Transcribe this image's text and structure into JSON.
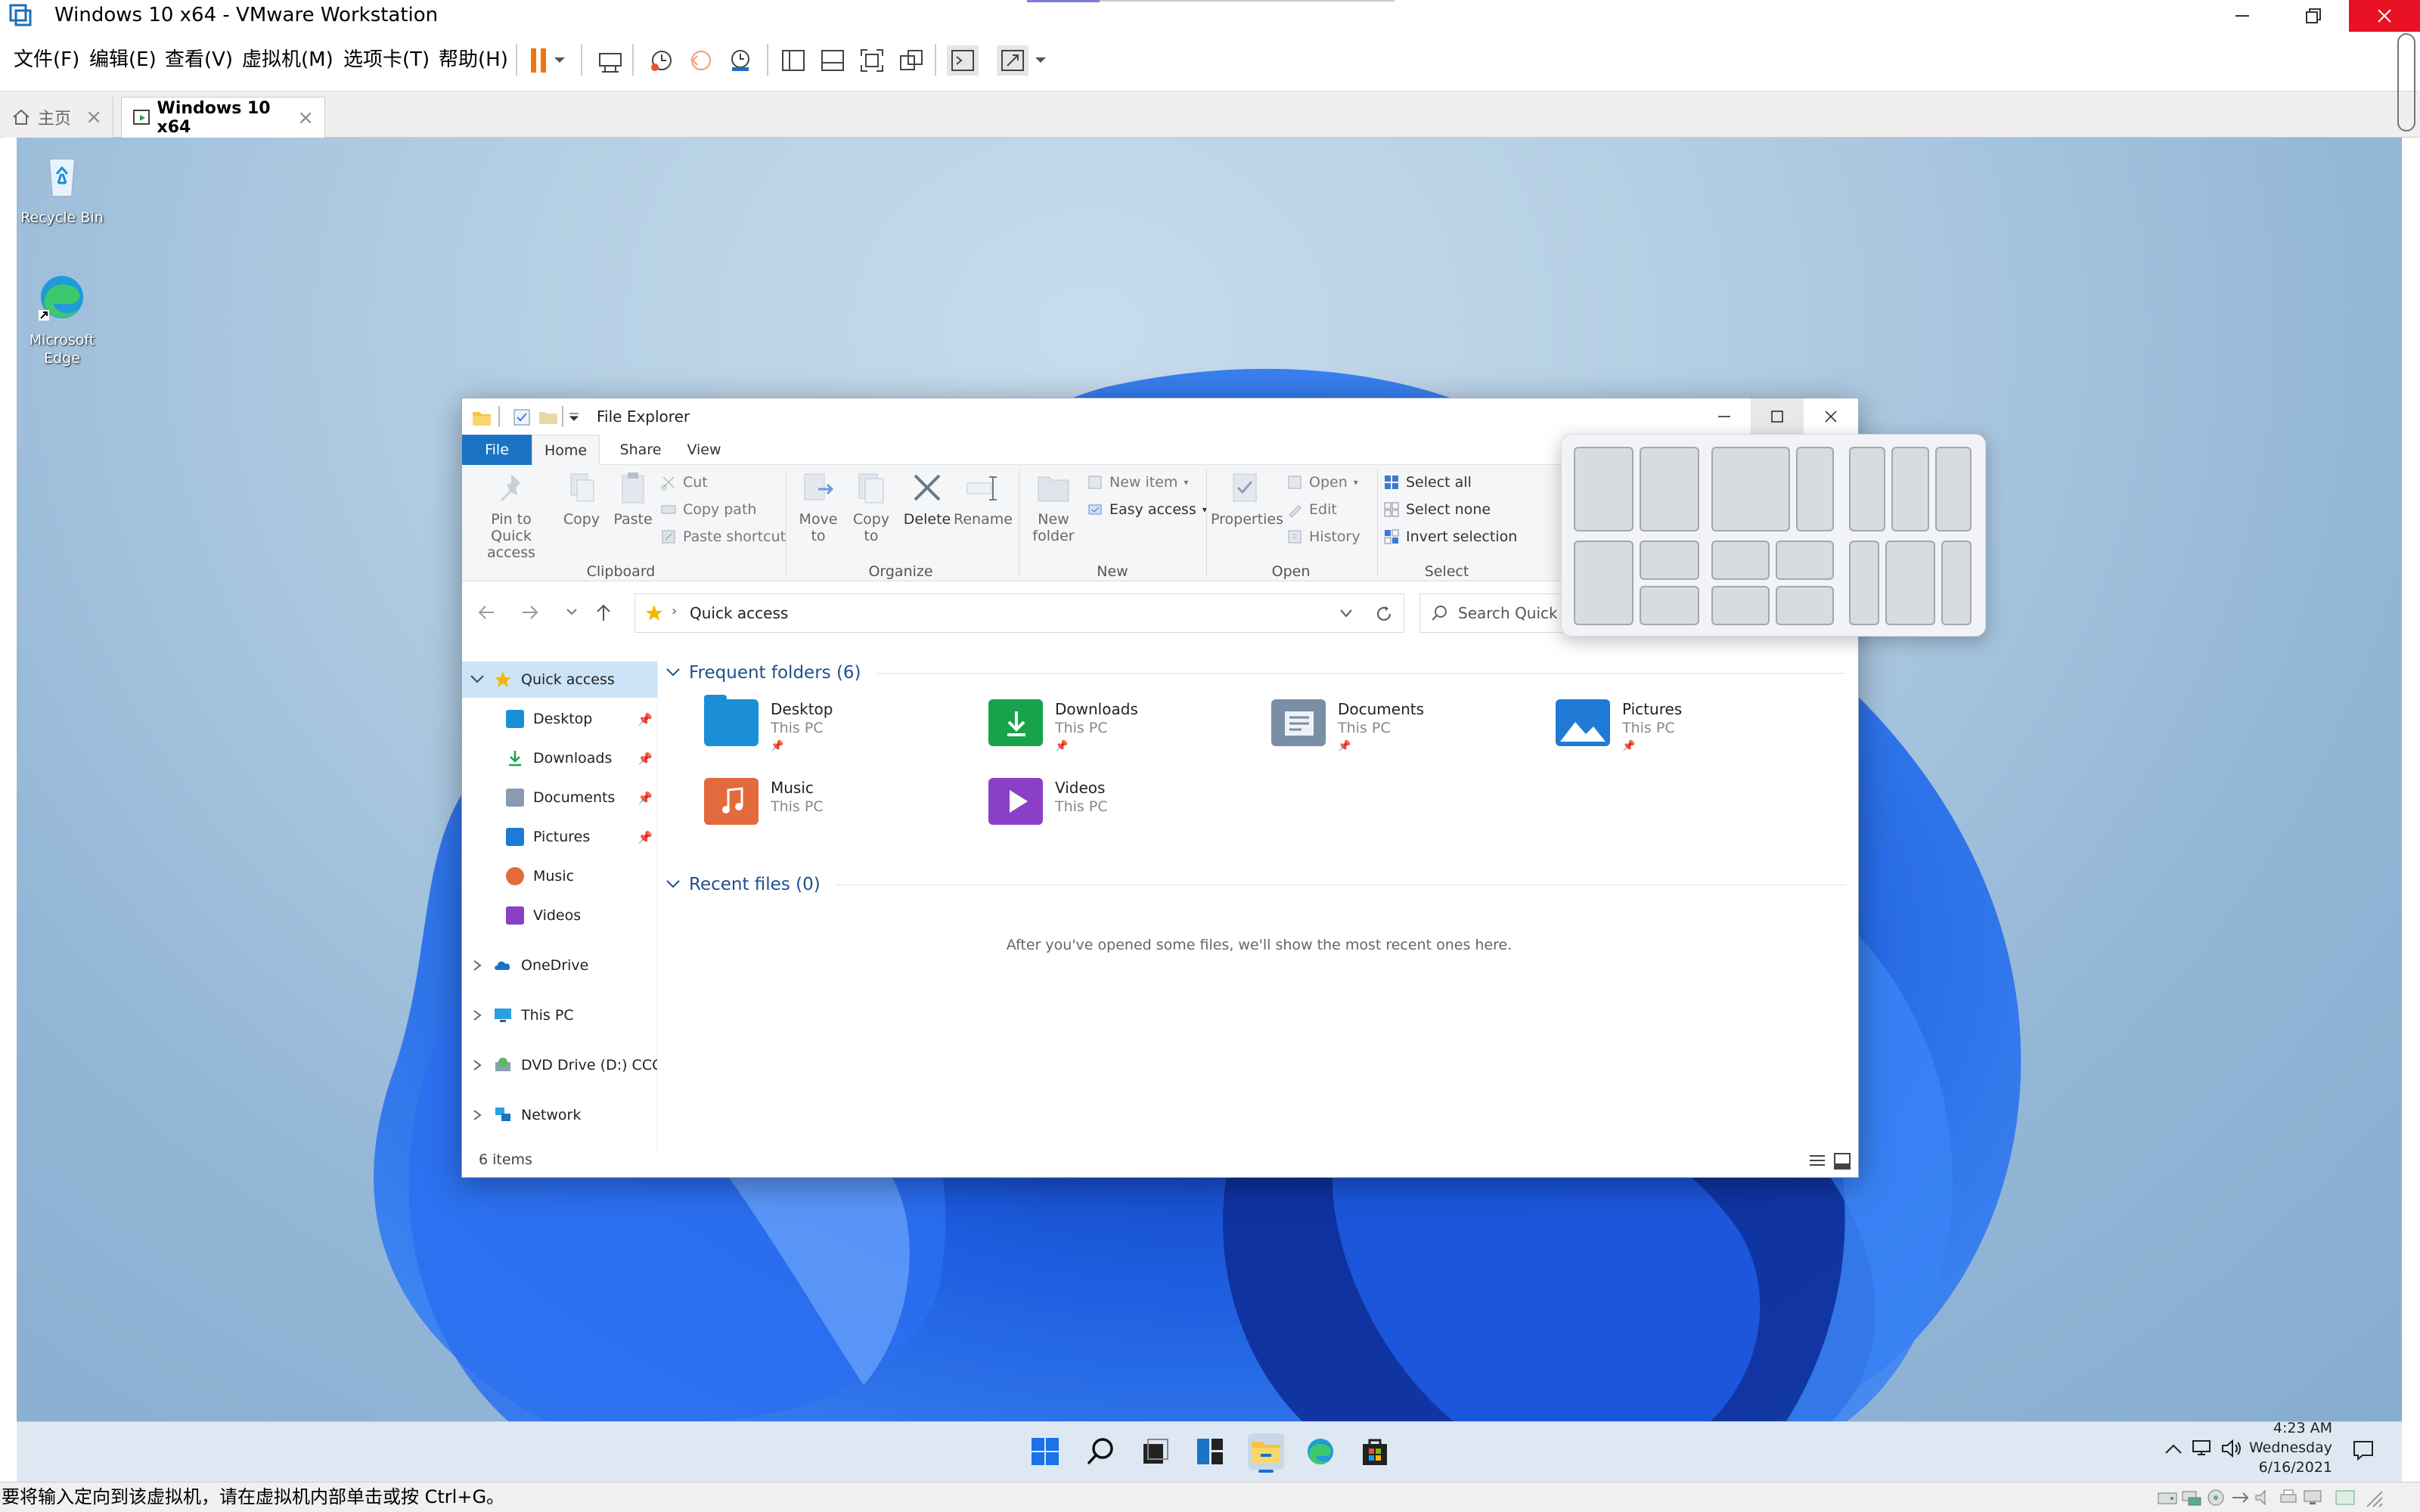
{
  "window": {
    "title": "Windows 10 x64 - VMware Workstation"
  },
  "menu": {
    "items": [
      "文件(F)",
      "编辑(E)",
      "查看(V)",
      "虚拟机(M)",
      "选项卡(T)",
      "帮助(H)"
    ]
  },
  "tabs": [
    {
      "label": "主页"
    },
    {
      "label": "Windows 10 x64"
    }
  ],
  "desktop": {
    "icons": [
      {
        "label": "Recycle Bin"
      },
      {
        "label": "Microsoft Edge"
      }
    ]
  },
  "explorer": {
    "title": "File Explorer",
    "ribbon_tabs": [
      "File",
      "Home",
      "Share",
      "View"
    ],
    "clipboard": {
      "pin": "Pin to Quick access",
      "copy": "Copy",
      "paste": "Paste",
      "cut": "Cut",
      "copy_path": "Copy path",
      "paste_shortcut": "Paste shortcut",
      "label": "Clipboard"
    },
    "organize": {
      "move_to": "Move to",
      "copy_to": "Copy to",
      "delete": "Delete",
      "rename": "Rename",
      "label": "Organize"
    },
    "new": {
      "new_folder": "New folder",
      "new_item": "New item",
      "easy_access": "Easy access",
      "label": "New"
    },
    "open": {
      "properties": "Properties",
      "open": "Open",
      "edit": "Edit",
      "history": "History",
      "label": "Open"
    },
    "select": {
      "select_all": "Select all",
      "select_none": "Select none",
      "invert": "Invert selection",
      "label": "Select"
    },
    "address": {
      "path": "Quick access",
      "search_placeholder": "Search Quick"
    },
    "nav": {
      "quick_access": "Quick access",
      "items": [
        "Desktop",
        "Downloads",
        "Documents",
        "Pictures",
        "Music",
        "Videos"
      ],
      "onedrive": "OneDrive",
      "this_pc": "This PC",
      "dvd": "DVD Drive (D:) CCCC",
      "network": "Network"
    },
    "frequent": {
      "header": "Frequent folders (6)",
      "folders": [
        {
          "name": "Desktop",
          "location": "This PC",
          "color": "#1a8fd8"
        },
        {
          "name": "Downloads",
          "location": "This PC",
          "color": "#16a34a"
        },
        {
          "name": "Documents",
          "location": "This PC",
          "color": "#7a8ea6"
        },
        {
          "name": "Pictures",
          "location": "This PC",
          "color": "#1f7ad6"
        },
        {
          "name": "Music",
          "location": "This PC",
          "color": "#e26a3c"
        },
        {
          "name": "Videos",
          "location": "This PC",
          "color": "#8b3fc7"
        }
      ]
    },
    "recent": {
      "header": "Recent files (0)",
      "empty_message": "After you've opened some files, we'll show the most recent ones here."
    },
    "status": {
      "items_count": "6 items"
    }
  },
  "taskbar": {
    "time": "4:23 AM",
    "day": "Wednesday",
    "date": "6/16/2021"
  },
  "vm_status": {
    "hint": "要将输入定向到该虚拟机，请在虚拟机内部单击或按 Ctrl+G。"
  },
  "colors": {
    "accent": "#1a73c4",
    "close_red": "#e81123"
  }
}
